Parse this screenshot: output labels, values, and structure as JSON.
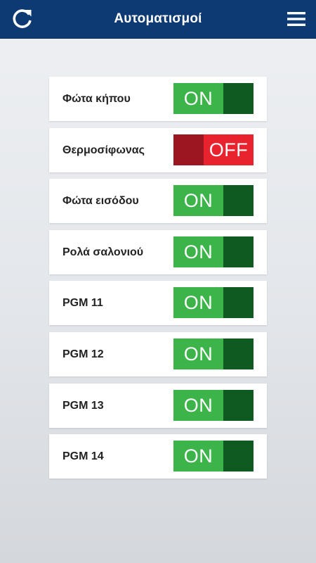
{
  "header": {
    "title": "Αυτοματισμοί",
    "refresh_icon": "refresh-icon",
    "menu_icon": "hamburger-menu-icon",
    "background_color": "#0d3a73"
  },
  "colors": {
    "on_light": "#3cb44a",
    "on_dark": "#0f5a21",
    "off_light": "#e8232e",
    "off_dark": "#9b1620"
  },
  "items": [
    {
      "label": "Φώτα κήπου",
      "state": "on",
      "state_text": "ON"
    },
    {
      "label": "Θερμοσίφωνας",
      "state": "off",
      "state_text": "OFF"
    },
    {
      "label": "Φώτα εισόδου",
      "state": "on",
      "state_text": "ON"
    },
    {
      "label": "Ρολά σαλονιού",
      "state": "on",
      "state_text": "ON"
    },
    {
      "label": "PGM 11",
      "state": "on",
      "state_text": "ON"
    },
    {
      "label": "PGM 12",
      "state": "on",
      "state_text": "ON"
    },
    {
      "label": "PGM 13",
      "state": "on",
      "state_text": "ON"
    },
    {
      "label": "PGM 14",
      "state": "on",
      "state_text": "ON"
    }
  ]
}
